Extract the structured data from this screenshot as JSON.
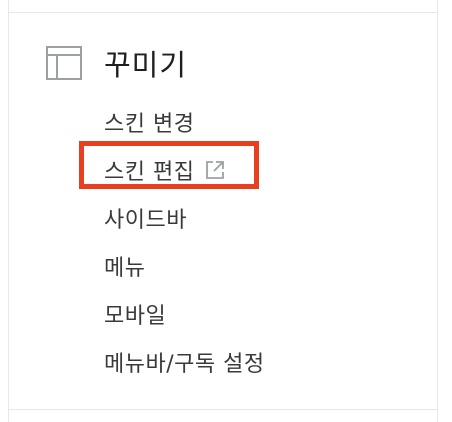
{
  "section": {
    "icon": "layout-icon",
    "title": "꾸미기"
  },
  "menu": {
    "items": [
      {
        "label": "스킨 변경"
      },
      {
        "label": "스킨 편집",
        "icon": "external-link-icon",
        "highlighted": true
      },
      {
        "label": "사이드바"
      },
      {
        "label": "메뉴"
      },
      {
        "label": "모바일"
      },
      {
        "label": "메뉴바/구독 설정"
      }
    ]
  },
  "colors": {
    "highlight_border": "#e8401f",
    "text": "#3a3a3a",
    "title": "#1f1f1f",
    "divider": "#e6e8ec",
    "icon": "#9aa0a6"
  }
}
